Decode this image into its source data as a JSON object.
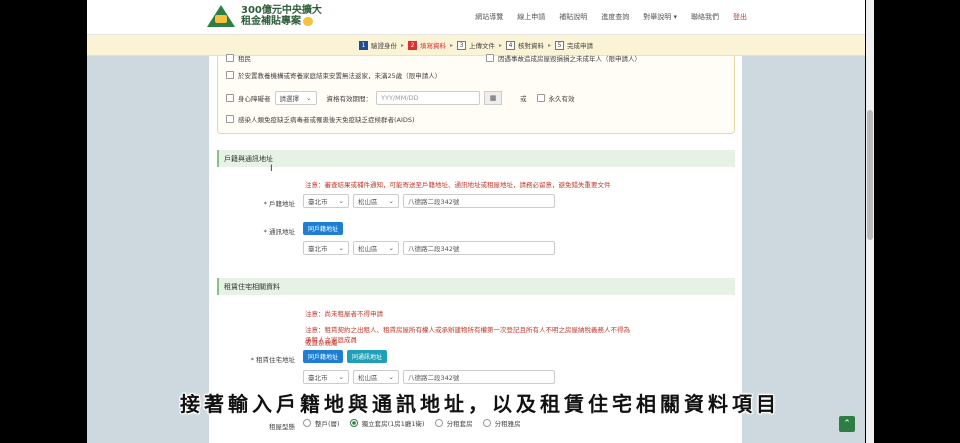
{
  "logo": {
    "line1": "300億元中央擴大",
    "line2": "租金補貼專案"
  },
  "nav": [
    "網站導覽",
    "線上申請",
    "補貼說明",
    "進度查詢",
    "對舉說明 ▾",
    "聯絡我們",
    "登出"
  ],
  "steps": [
    {
      "num": "1",
      "label": "驗證身份",
      "state": "done"
    },
    {
      "num": "2",
      "label": "填寫資料",
      "state": "active"
    },
    {
      "num": "3",
      "label": "上傳文件",
      "state": "todo"
    },
    {
      "num": "4",
      "label": "核對資料",
      "state": "todo"
    },
    {
      "num": "5",
      "label": "完成申請",
      "state": "todo"
    }
  ],
  "identity": {
    "row0_left": "租民",
    "row0_right": "因遇事故造成房屋毀損損之未成年人（限申請人）",
    "row1": "於安置教養機構或寄養家庭結束安置無法返家，未滿25歲（限申請人）",
    "disability_label": "身心障礙者",
    "disability_select": "請選擇",
    "valid_label": "資格有效期間：",
    "date_placeholder": "YYY/MM/DD",
    "or": "或",
    "permanent": "永久有效",
    "row3": "感染人類免疫缺乏病毒者或罹患後天免疫缺乏症候群者(AIDS)"
  },
  "household": {
    "title": "戶籍與通訊地址",
    "note": "注意：審查結果或補件通知，可能寄送至戶籍地址、通訊地址或租屋地址，請務必留意，避免錯失重要文件",
    "reg_label": "* 戶籍地址",
    "reg_city": "臺北市",
    "reg_district": "松山區",
    "reg_street": "八德路二段342號",
    "mail_label": "* 通訊地址",
    "same_btn": "同戶籍地址",
    "mail_city": "臺北市",
    "mail_district": "松山區",
    "mail_street": "八德路二段342號"
  },
  "rental": {
    "title": "租賃住宅相關資料",
    "note1": "注意：尚未租屋者不得申請",
    "note2a": "注意：租賃契約之出租人、租賃房屋所有權人或承辦建物所有權第一次登記且所有人不明之房屋納稅義務人不得為承租人之家庭成員",
    "note2b": "或直系親屬",
    "addr_label": "* 租賃住宅地址",
    "btn_reg": "同戶籍地址",
    "btn_mail": "同通訊地址",
    "city": "臺北市",
    "district": "松山區",
    "street": "八德路二段342號",
    "type_label": "租屋型態",
    "types": [
      "整戶(層)",
      "獨立套房(1房1廳1衛)",
      "分租套房",
      "分租雅房"
    ],
    "selected_type": 1
  },
  "caption": "接著輸入戶籍地與通訊地址，以及租賃住宅相關資料項目",
  "to_top": "⌃"
}
